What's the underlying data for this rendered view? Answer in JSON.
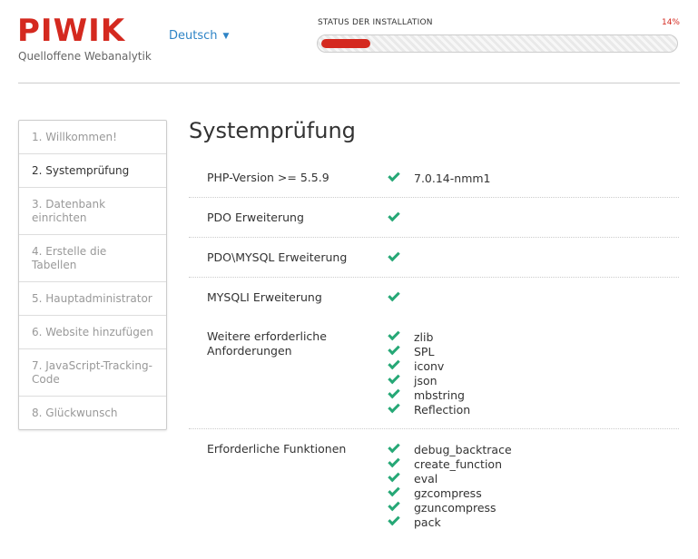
{
  "header": {
    "logo": "PIWIK",
    "tagline": "Quelloffene Webanalytik",
    "language": "Deutsch",
    "status_label": "STATUS DER INSTALLATION",
    "progress_text": "14%",
    "progress_value": 0.14
  },
  "sidebar": {
    "steps": [
      {
        "label": "1. Willkommen!"
      },
      {
        "label": "2. Systemprüfung"
      },
      {
        "label": "3. Datenbank einrichten"
      },
      {
        "label": "4. Erstelle die Tabellen"
      },
      {
        "label": "5. Hauptadministrator"
      },
      {
        "label": "6. Website hinzufügen"
      },
      {
        "label": "7. JavaScript-Tracking-Code"
      },
      {
        "label": "8. Glückwunsch"
      }
    ]
  },
  "main": {
    "title": "Systemprüfung",
    "checks": [
      {
        "label": "PHP-Version >= 5.5.9",
        "items": [
          "7.0.14-nmm1"
        ]
      },
      {
        "label": "PDO Erweiterung",
        "items": [
          ""
        ]
      },
      {
        "label": "PDO\\MYSQL Erweiterung",
        "items": [
          ""
        ]
      },
      {
        "label": "MYSQLI Erweiterung",
        "items": [
          ""
        ]
      },
      {
        "label": "Weitere erforderliche Anforderungen",
        "items": [
          "zlib",
          "SPL",
          "iconv",
          "json",
          "mbstring",
          "Reflection"
        ]
      },
      {
        "label": "Erforderliche Funktionen",
        "items": [
          "debug_backtrace",
          "create_function",
          "eval",
          "gzcompress",
          "gzuncompress",
          "pack"
        ]
      }
    ]
  },
  "colors": {
    "brand_red": "#d4291f",
    "check_green": "#26a876",
    "link_blue": "#2e84c6"
  },
  "icons": {
    "check": "check-icon",
    "caret": "caret-down-icon"
  }
}
